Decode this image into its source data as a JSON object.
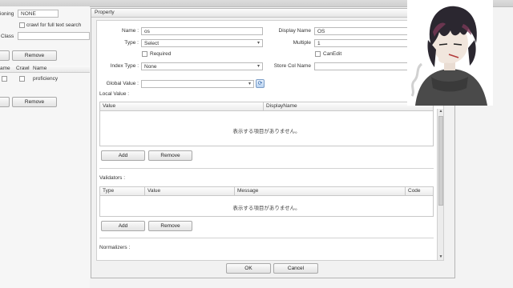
{
  "top_bar": {},
  "left_panel": {
    "versioning_label": "ioning",
    "versioning_value": "NONE",
    "crawl_label": "crawl for full text search",
    "class_label": "Class",
    "remove_1": "Remove",
    "grid_headers": [
      "ame",
      "Crawl",
      "Name"
    ],
    "row_name": "proficiency",
    "remove_2": "Remove"
  },
  "dialog": {
    "title": "Property",
    "name_label": "Name :",
    "name_value": "os",
    "display_name_label": "Display Name",
    "display_name_value": "OS",
    "type_label": "Type :",
    "type_value": "Select",
    "multiple_label": "Multiple",
    "multiple_value": "1",
    "required_label": "Required",
    "can_edit_label": "CanEdit",
    "index_type_label": "Index Type :",
    "index_type_value": "None",
    "store_col_label": "Store Col Name",
    "global_value_label": "Global Value :",
    "local_value_label": "Local Value :",
    "local_headers": [
      "Value",
      "DisplayName"
    ],
    "empty_text": "表示する項目がありません。",
    "add_label": "Add",
    "remove_label": "Remove",
    "validators_label": "Validators :",
    "validator_headers": [
      "Type",
      "Value",
      "Message",
      "Code"
    ],
    "normalizers_label": "Normalizers :",
    "ok_label": "OK",
    "cancel_label": "Cancel"
  },
  "overlay": {
    "avatar_icon": "anime-character-avatar"
  }
}
